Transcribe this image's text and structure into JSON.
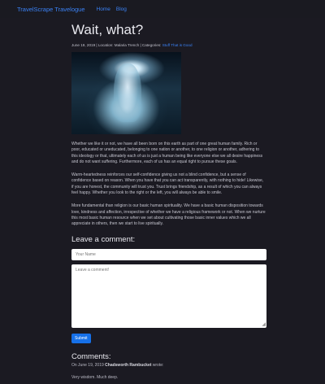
{
  "navbar": {
    "brand": "TravelScrape Travelogue",
    "links": [
      "Home",
      "Blog"
    ]
  },
  "post": {
    "title": "Wait, what?",
    "meta_prefix": "June 19, 2019 | Location: Malaria Trench | Categories:",
    "category": "Stuff That is Good",
    "paragraphs": [
      "Whether we like it or not, we have all been born on this earth as part of one great human family. Rich or poor, educated or uneducated, belonging to one nation or another, to one religion or another, adhering to this ideology or that, ultimately each of us is just a human being like everyone else we all desire happiness and do not want suffering. Furthermore, each of us has an equal right to pursue these goals.",
      "Warm-heartedness reinforces our self-confidence giving us not a blind confidence, but a sense of confidence based on reason. When you have that you can act transparently, with nothing to hide! Likewise, if you are honest, the community will trust you. Trust brings friendship, as a result of which you can always feel happy. Whether you look to the right or the left, you will always be able to smile.",
      "More fundamental than religion is our basic human spirituality. We have a basic human disposition towards love, kindness and affection, irrespective of whether we have a religious framework or not. When we nurture this most basic human resource when we set about cultivating those basic inner values which we all appreciate in others, then we start to live spiritually."
    ]
  },
  "comment_form": {
    "heading": "Leave a comment:",
    "name_placeholder": "Your Name",
    "comment_placeholder": "Leave a comment!",
    "submit_label": "Submit"
  },
  "comments": {
    "heading": "Comments:",
    "items": [
      {
        "date_prefix": "On June 19, 2019",
        "author": "Chadsworth Rambucket",
        "suffix": "wrote:",
        "text": "Very wisdom. Much deep."
      }
    ]
  },
  "colors": {
    "background": "#1b1a22",
    "link": "#3b82f6",
    "button": "#1670e8"
  }
}
